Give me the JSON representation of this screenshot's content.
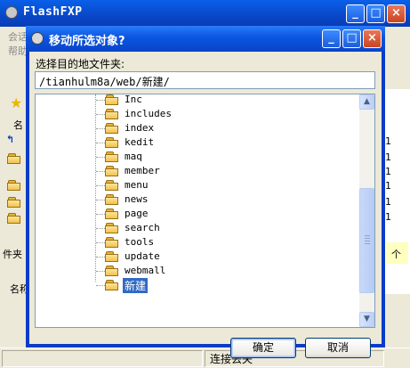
{
  "background_window": {
    "title": "FlashFXP",
    "menu_fragments": [
      "会话",
      "帮助"
    ],
    "left_labels": [
      "名",
      "件夹",
      "名称"
    ],
    "right_digits": [
      "1",
      "1",
      "1",
      "1",
      "1",
      "1"
    ],
    "right_label": "个",
    "status_text": "连接丢失"
  },
  "dialog": {
    "title": "移动所选对象?",
    "path_label": "选择目的地文件夹:",
    "path_value": "/tianhulm8a/web/新建/",
    "folders": [
      "Inc",
      "includes",
      "index",
      "kedit",
      "maq",
      "member",
      "menu",
      "news",
      "page",
      "search",
      "tools",
      "update",
      "webmall",
      "新建"
    ],
    "selected_folder": "新建",
    "ok_label": "确定",
    "cancel_label": "取消"
  },
  "colors": {
    "titlebar": "#0A55E0",
    "selection": "#316AC5",
    "folder": "#F2C24E"
  },
  "icons": [
    "flashfxp-icon",
    "minimize-icon",
    "maximize-icon",
    "close-icon",
    "folder-icon",
    "scroll-up-icon",
    "scroll-down-icon"
  ]
}
